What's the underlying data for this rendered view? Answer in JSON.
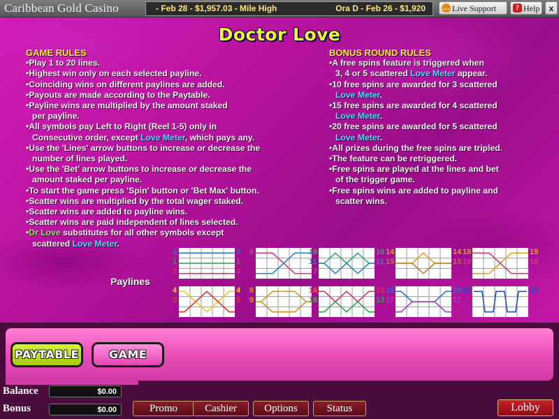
{
  "topbar": {
    "brand": "Caribbean Gold Casino",
    "ticker_left": "- Feb 28 - $1,957.03 - Mile High",
    "ticker_right": "Ora D - Feb 26 - $1,920",
    "support_label": "Live Support",
    "help_label": "Help",
    "close_label": "x"
  },
  "title": "Doctor Love",
  "game_rules": {
    "heading": "GAME RULES",
    "lines": [
      "•Play 1 to 20 lines.",
      "•Highest win only on each selected payline.",
      "•Coinciding wins on different paylines are added.",
      "•Payouts are made according to the Paytable.",
      "•Payline wins are multiplied by the amount staked",
      "per payline.",
      "•All symbols pay Left to Right (Reel 1-5) only in",
      "Consecutive order, except ",
      "Love Meter",
      ", which pays any.",
      "•Use the 'Lines' arrow buttons to increase or decrease the",
      "number of lines played.",
      "•Use the 'Bet' arrow buttons to increase or decrease the",
      "amount staked per payline.",
      "•To start the game press 'Spin' button or 'Bet Max' button.",
      "•Scatter wins are multiplied by the total wager staked.",
      "•Scatter wins are added to payline wins.",
      "•Scatter wins are paid independent of lines selected.",
      "•",
      "Dr Love",
      " substitutes for all other symbols except",
      "scattered ",
      "Love Meter",
      "."
    ]
  },
  "bonus_rules": {
    "heading": "BONUS ROUND RULES",
    "lines": [
      "•A free spins feature is triggered when",
      "3, 4 or 5 scattered ",
      "Love Meter",
      " appear.",
      "•10 free spins are awarded for 3 scattered",
      "Love Meter",
      ".",
      "•15 free spins are awarded for 4 scattered",
      "Love Meter",
      ".",
      "•20 free spins are awarded for 5 scattered",
      "Love Meter",
      ".",
      "•All prizes during the free spins are tripled.",
      "•The feature can be retriggered.",
      "•Free spins are played at the lines and bet",
      "of the trigger game.",
      "•Free spins wins are added to payline and",
      "scatter wins."
    ]
  },
  "paylines": {
    "label": "Paylines",
    "groups": [
      {
        "nums_left": [
          "2",
          "1",
          "3"
        ],
        "nums_right": [
          "2",
          "1",
          "3"
        ],
        "colors": [
          "#2b6fd6",
          "#22a04a",
          "#e0305a"
        ],
        "rows": [
          [
            0,
            0,
            0,
            0,
            0
          ],
          [
            1,
            1,
            1,
            1,
            1
          ],
          [
            2,
            2,
            2,
            2,
            2
          ]
        ]
      },
      {
        "nums_left": [
          "6",
          "",
          ""
        ],
        "nums_right": [
          "6",
          "",
          "7"
        ],
        "colors": [
          "#d23a8a",
          "#1e88c8"
        ],
        "rows": [
          [
            0,
            0,
            1,
            2,
            2
          ],
          [
            2,
            2,
            1,
            0,
            0
          ]
        ],
        "num_colors": [
          "#d23a8a",
          "#1e88c8"
        ]
      },
      {
        "nums_left": [
          "10",
          "11",
          ""
        ],
        "nums_right": [
          "10",
          "11",
          ""
        ],
        "colors": [
          "#2aa67a",
          "#1e88c8"
        ],
        "rows": [
          [
            1,
            0,
            1,
            0,
            1
          ],
          [
            1,
            2,
            1,
            2,
            1
          ]
        ]
      },
      {
        "nums_left": [
          "14",
          "15",
          ""
        ],
        "nums_right": [
          "14",
          "15",
          ""
        ],
        "colors": [
          "#d9a413",
          "#c8781e"
        ],
        "rows": [
          [
            1,
            1,
            0,
            1,
            1
          ],
          [
            1,
            1,
            2,
            1,
            1
          ]
        ]
      },
      {
        "nums_left": [
          "18",
          "19",
          ""
        ],
        "nums_right": [
          "19",
          "18",
          ""
        ],
        "colors": [
          "#e0a020",
          "#d23a7a"
        ],
        "rows": [
          [
            2,
            2,
            1,
            0,
            0
          ],
          [
            0,
            0,
            1,
            2,
            2
          ]
        ]
      },
      {
        "nums_left": [
          "4",
          "5",
          ""
        ],
        "nums_right": [
          "4",
          "5",
          ""
        ],
        "colors": [
          "#e8d020",
          "#e03030"
        ],
        "rows": [
          [
            0,
            1,
            2,
            1,
            0
          ],
          [
            2,
            1,
            0,
            1,
            2
          ]
        ]
      },
      {
        "nums_left": [
          "8",
          "9",
          ""
        ],
        "nums_right": [
          "8",
          "9",
          ""
        ],
        "colors": [
          "#d88a20",
          "#c8a020"
        ],
        "rows": [
          [
            1,
            2,
            2,
            2,
            1
          ],
          [
            1,
            0,
            0,
            0,
            1
          ]
        ]
      },
      {
        "nums_left": [
          "12",
          "13",
          ""
        ],
        "nums_right": [
          "12",
          "13",
          ""
        ],
        "colors": [
          "#e0305a",
          "#2aa64a"
        ],
        "rows": [
          [
            0,
            1,
            0,
            1,
            0
          ],
          [
            2,
            1,
            2,
            1,
            2
          ]
        ]
      },
      {
        "nums_left": [
          "16",
          "17",
          ""
        ],
        "nums_right": [
          "16",
          "17",
          ""
        ],
        "colors": [
          "#2b6fd6",
          "#a03ac8"
        ],
        "rows": [
          [
            0,
            1,
            1,
            1,
            0
          ],
          [
            2,
            1,
            1,
            1,
            2
          ]
        ]
      },
      {
        "nums_left": [
          "20",
          "",
          ""
        ],
        "nums_right": [
          "20",
          "",
          ""
        ],
        "colors": [
          "#1e4fb8"
        ],
        "rows": [
          [
            0,
            2,
            0,
            2,
            0
          ]
        ]
      }
    ]
  },
  "buttons": {
    "paytable": "PAYTABLE",
    "game": "GAME"
  },
  "status": {
    "balance_label": "Balance",
    "balance_value": "$0.00",
    "bonus_label": "Bonus",
    "bonus_value": "$0.00"
  },
  "nav": {
    "promo": "Promo",
    "cashier": "Cashier",
    "options": "Options",
    "status": "Status",
    "lobby": "Lobby"
  }
}
